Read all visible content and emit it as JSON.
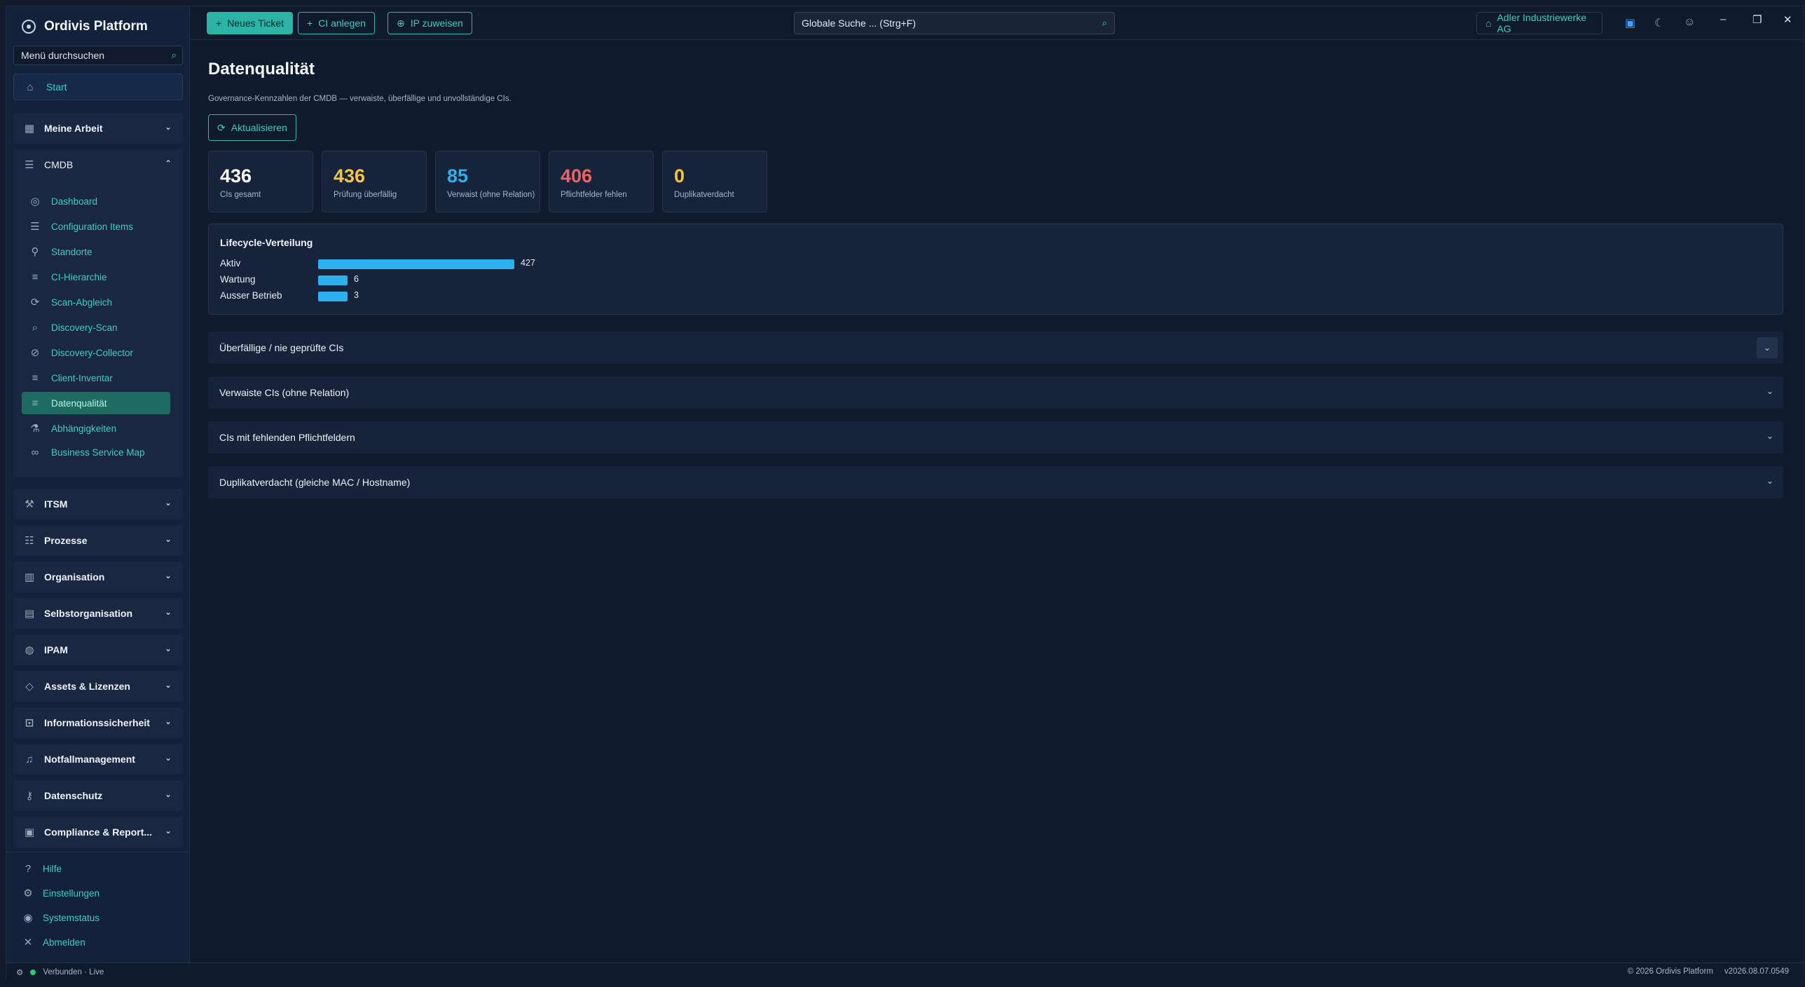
{
  "app": {
    "title": "Ordivis Platform"
  },
  "sidebar": {
    "search_placeholder": "Menü durchsuchen",
    "start": "Start",
    "groups": {
      "meine_arbeit": "Meine Arbeit",
      "cmdb": "CMDB",
      "itsm": "ITSM",
      "prozesse": "Prozesse",
      "organisation": "Organisation",
      "selbstorganisation": "Selbstorganisation",
      "ipam": "IPAM",
      "assets": "Assets & Lizenzen",
      "infosec": "Informationssicherheit",
      "notfall": "Notfallmanagement",
      "datenschutz": "Datenschutz",
      "compliance": "Compliance & Report..."
    },
    "cmdb_items": [
      {
        "label": "Dashboard",
        "icon": "eye-icon"
      },
      {
        "label": "Configuration Items",
        "icon": "list-icon"
      },
      {
        "label": "Standorte",
        "icon": "pin-icon"
      },
      {
        "label": "CI-Hierarchie",
        "icon": "lines-icon"
      },
      {
        "label": "Scan-Abgleich",
        "icon": "sync-icon"
      },
      {
        "label": "Discovery-Scan",
        "icon": "search-icon"
      },
      {
        "label": "Discovery-Collector",
        "icon": "compass-icon"
      },
      {
        "label": "Client-Inventar",
        "icon": "lines-icon"
      },
      {
        "label": "Datenqualität",
        "icon": "lines-icon"
      },
      {
        "label": "Abhängigkeiten",
        "icon": "flask-icon"
      },
      {
        "label": "Business Service Map",
        "icon": "link-icon"
      }
    ],
    "footer": {
      "help": "Hilfe",
      "settings": "Einstellungen",
      "status": "Systemstatus",
      "logout": "Abmelden"
    }
  },
  "topbar": {
    "new_ticket": "Neues Ticket",
    "ci_create": "CI anlegen",
    "ip_assign": "IP zuweisen",
    "global_search": "Globale Suche ... (Strg+F)",
    "tenant": "Adler Industriewerke AG"
  },
  "page": {
    "title": "Datenqualität",
    "subtitle": "Governance-Kennzahlen der CMDB — verwaiste, überfällige und unvollständige CIs.",
    "refresh": "Aktualisieren",
    "kpis": [
      {
        "value": "436",
        "label": "CIs gesamt",
        "color": "#ffffff"
      },
      {
        "value": "436",
        "label": "Prüfung überfällig",
        "color": "#f4c542"
      },
      {
        "value": "85",
        "label": "Verwaist (ohne Relation)",
        "color": "#2eb0ef"
      },
      {
        "value": "406",
        "label": "Pflichtfelder fehlen",
        "color": "#ef6262"
      },
      {
        "value": "0",
        "label": "Duplikatverdacht",
        "color": "#f4c542"
      }
    ],
    "lifecycle": {
      "title": "Lifecycle-Verteilung",
      "rows": [
        {
          "label": "Aktiv",
          "value": 427
        },
        {
          "label": "Wartung",
          "value": 6
        },
        {
          "label": "Ausser Betrieb",
          "value": 3
        }
      ]
    },
    "sections": [
      "Überfällige / nie geprüfte CIs",
      "Verwaiste CIs (ohne Relation)",
      "CIs mit fehlenden Pflichtfeldern",
      "Duplikatverdacht (gleiche MAC / Hostname)"
    ]
  },
  "statusbar": {
    "connection": "Verbunden · Live",
    "copyright": "© 2026 Ordivis Platform",
    "version": "v2026.08.07.0549"
  }
}
